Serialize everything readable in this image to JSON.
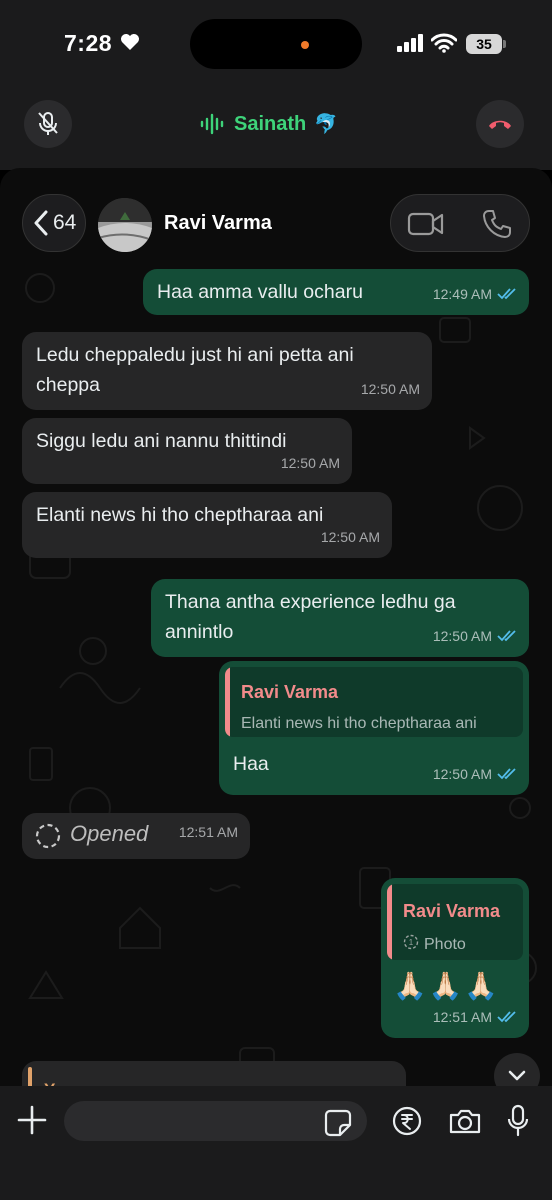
{
  "status_bar": {
    "time": "7:28",
    "battery": "35"
  },
  "call": {
    "name": "Sainath",
    "emoji": "🐬"
  },
  "header": {
    "back_count": "64",
    "contact_name": "Ravi Varma"
  },
  "messages": [
    {
      "text": "Haa amma vallu ocharu",
      "time": "12:49 AM"
    },
    {
      "text_lines": [
        "Ledu cheppaledu just hi ani petta ani",
        "cheppa"
      ],
      "time": "12:50 AM"
    },
    {
      "text": "Siggu ledu ani nannu thittindi",
      "time": "12:50 AM"
    },
    {
      "text": "Elanti news hi tho cheptharaa ani",
      "time": "12:50 AM"
    },
    {
      "text_lines": [
        "Thana antha experience ledhu ga",
        "annintlo"
      ],
      "time": "12:50 AM"
    },
    {
      "quote_author": "Ravi Varma",
      "quote_text": "Elanti news hi tho cheptharaa ani",
      "text": "Haa",
      "time": "12:50 AM"
    },
    {
      "text": "Opened",
      "time": "12:51 AM"
    },
    {
      "quote_author": "Ravi Varma",
      "quote_text": "Photo",
      "text": "🙏🏻🙏🏻🙏🏻",
      "time": "12:51 AM"
    }
  ],
  "partial_reply_author": "You",
  "colors": {
    "outgoing": "#144d37",
    "incoming": "#262627",
    "accent_green": "#3ed37a",
    "quote_author": "#f28b8b",
    "read_ticks": "#53bdeb",
    "end_call": "#f15c6d"
  },
  "icons": [
    "heart-icon",
    "signal-icon",
    "wifi-icon",
    "mic-off-icon",
    "waveform-icon",
    "end-call-icon",
    "chevron-left-icon",
    "video-icon",
    "phone-icon",
    "read-ticks-icon",
    "view-once-icon",
    "chevron-down-icon",
    "plus-icon",
    "sticker-icon",
    "rupee-icon",
    "camera-icon",
    "mic-icon"
  ]
}
